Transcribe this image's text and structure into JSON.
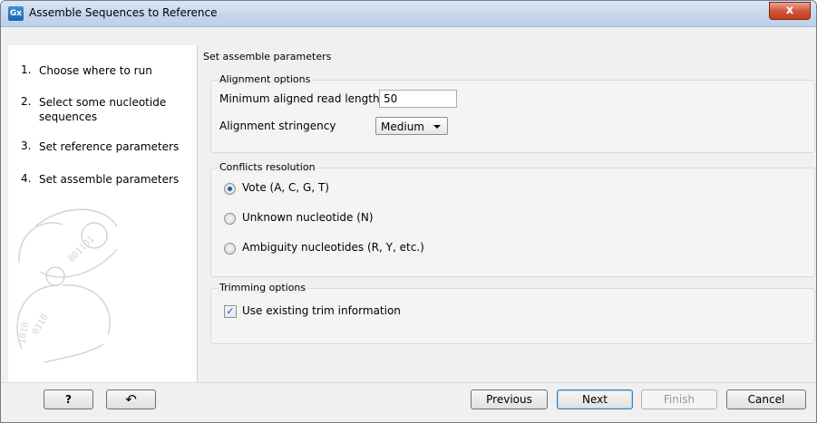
{
  "window": {
    "title": "Assemble Sequences to Reference",
    "app_icon_text": "Gx",
    "close_glyph": "x"
  },
  "steps": [
    {
      "num": "1.",
      "label": "Choose where to run"
    },
    {
      "num": "2.",
      "label": "Select some nucleotide sequences"
    },
    {
      "num": "3.",
      "label": "Set reference parameters"
    },
    {
      "num": "4.",
      "label": "Set assemble parameters"
    }
  ],
  "main": {
    "section_title": "Set assemble parameters",
    "alignment": {
      "legend": "Alignment options",
      "min_length_label": "Minimum aligned read length",
      "min_length_value": "50",
      "stringency_label": "Alignment stringency",
      "stringency_value": "Medium"
    },
    "conflicts": {
      "legend": "Conflicts resolution",
      "options": [
        {
          "label": "Vote (A, C, G, T)",
          "checked": true
        },
        {
          "label": "Unknown nucleotide (N)",
          "checked": false
        },
        {
          "label": "Ambiguity nucleotides (R, Y, etc.)",
          "checked": false
        }
      ]
    },
    "trimming": {
      "legend": "Trimming options",
      "use_trim_label": "Use existing trim information",
      "use_trim_checked": true,
      "check_glyph": "✓"
    }
  },
  "footer": {
    "help_label": "?",
    "reset_glyph": "↶",
    "previous_label": "Previous",
    "next_label": "Next",
    "finish_label": "Finish",
    "cancel_label": "Cancel"
  },
  "colors": {
    "titlebar": "#c5d6ea",
    "close_button": "#c43b1d",
    "radio_selected": "#1c5bb2"
  }
}
